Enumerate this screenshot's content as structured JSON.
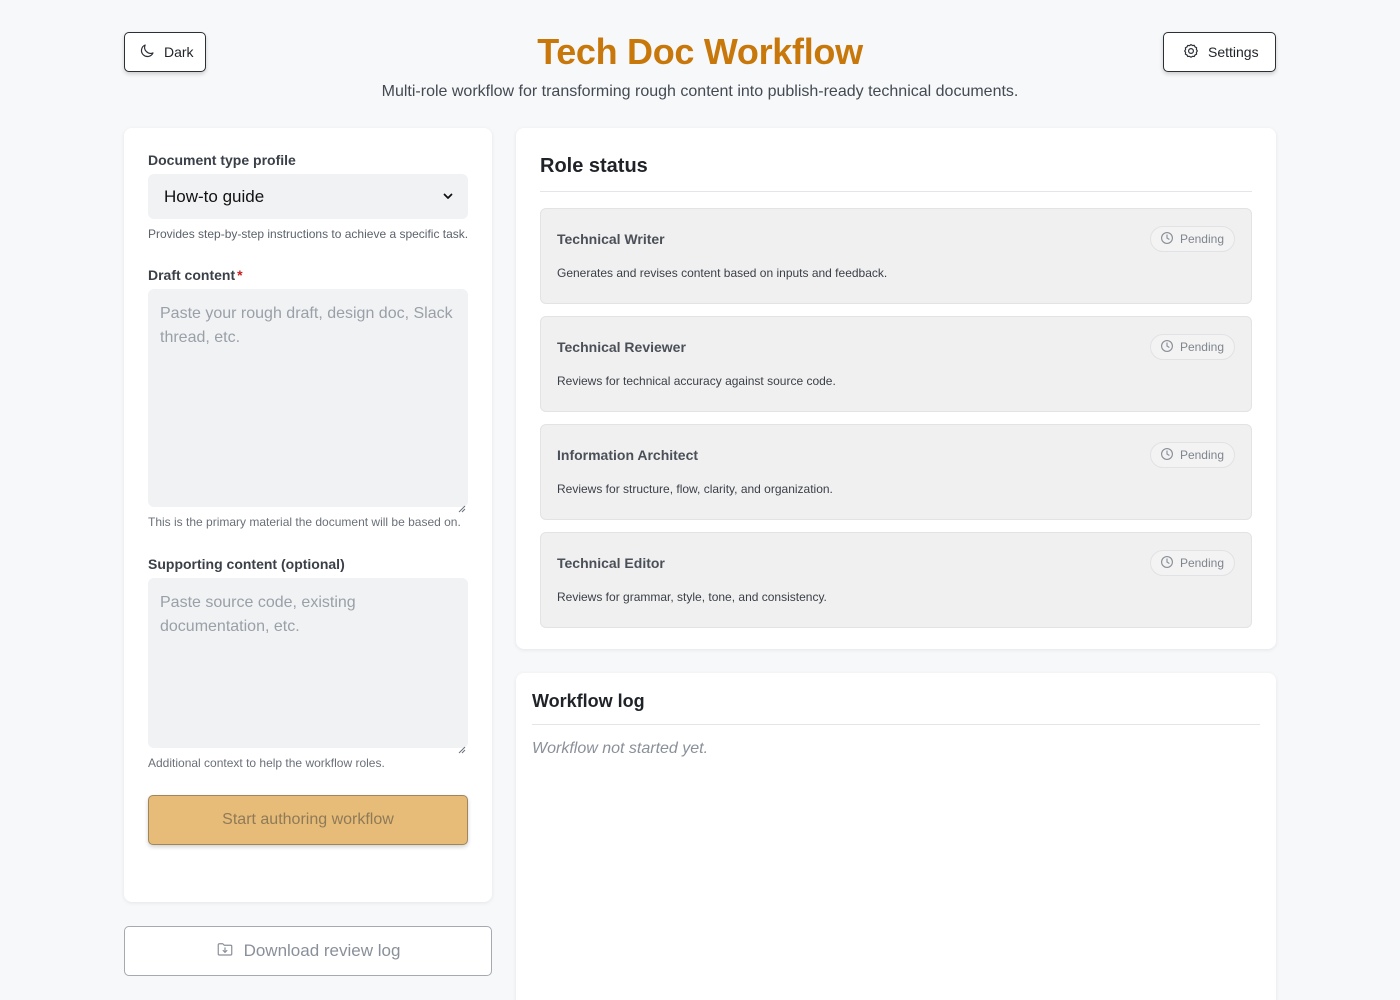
{
  "header": {
    "title": "Tech Doc Workflow",
    "subtitle": "Multi-role workflow for transforming rough content into publish-ready technical documents.",
    "dark_label": "Dark",
    "settings_label": "Settings"
  },
  "form": {
    "doc_type_label": "Document type profile",
    "doc_type_value": "How-to guide",
    "doc_type_help": "Provides step-by-step instructions to achieve a specific task.",
    "draft_label": "Draft content",
    "draft_required_mark": "*",
    "draft_placeholder": "Paste your rough draft, design doc, Slack thread, etc.",
    "draft_help": "This is the primary material the document will be based on.",
    "supporting_label": "Supporting content (optional)",
    "supporting_placeholder": "Paste source code, existing documentation, etc.",
    "supporting_help": "Additional context to help the workflow roles.",
    "start_button": "Start authoring workflow"
  },
  "download_button": "Download review log",
  "role_status": {
    "title": "Role status",
    "roles": [
      {
        "name": "Technical Writer",
        "description": "Generates and revises content based on inputs and feedback.",
        "status": "Pending"
      },
      {
        "name": "Technical Reviewer",
        "description": "Reviews for technical accuracy against source code.",
        "status": "Pending"
      },
      {
        "name": "Information Architect",
        "description": "Reviews for structure, flow, clarity, and organization.",
        "status": "Pending"
      },
      {
        "name": "Technical Editor",
        "description": "Reviews for grammar, style, tone, and consistency.",
        "status": "Pending"
      }
    ]
  },
  "workflow_log": {
    "title": "Workflow log",
    "empty_text": "Workflow not started yet."
  },
  "colors": {
    "accent": "#c8780a",
    "start_button_bg": "#e6bc78",
    "page_bg": "#f7f8fa"
  }
}
